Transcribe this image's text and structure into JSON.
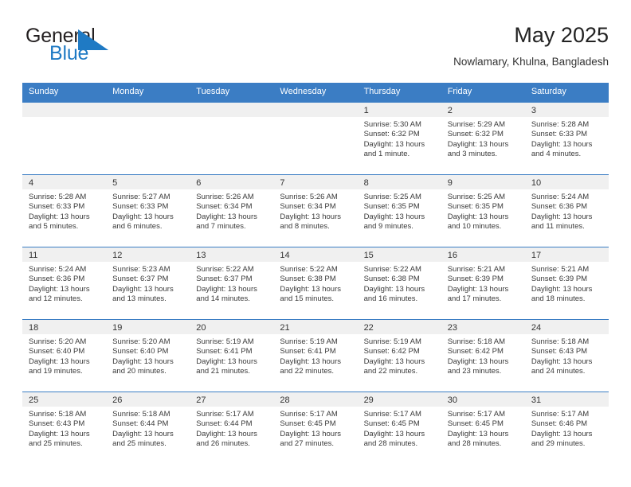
{
  "brand": {
    "name_part1": "General",
    "name_part2": "Blue",
    "accent_color": "#1f7ac4",
    "triangle_icon": "triangle-icon"
  },
  "header": {
    "title": "May 2025",
    "subtitle": "Nowlamary, Khulna, Bangladesh"
  },
  "calendar": {
    "header_bg": "#3b7dc4",
    "weekdays": [
      "Sunday",
      "Monday",
      "Tuesday",
      "Wednesday",
      "Thursday",
      "Friday",
      "Saturday"
    ],
    "weeks": [
      [
        {
          "day": "",
          "empty": true
        },
        {
          "day": "",
          "empty": true
        },
        {
          "day": "",
          "empty": true
        },
        {
          "day": "",
          "empty": true
        },
        {
          "day": "1",
          "sunrise": "Sunrise: 5:30 AM",
          "sunset": "Sunset: 6:32 PM",
          "daylight": "Daylight: 13 hours and 1 minute."
        },
        {
          "day": "2",
          "sunrise": "Sunrise: 5:29 AM",
          "sunset": "Sunset: 6:32 PM",
          "daylight": "Daylight: 13 hours and 3 minutes."
        },
        {
          "day": "3",
          "sunrise": "Sunrise: 5:28 AM",
          "sunset": "Sunset: 6:33 PM",
          "daylight": "Daylight: 13 hours and 4 minutes."
        }
      ],
      [
        {
          "day": "4",
          "sunrise": "Sunrise: 5:28 AM",
          "sunset": "Sunset: 6:33 PM",
          "daylight": "Daylight: 13 hours and 5 minutes."
        },
        {
          "day": "5",
          "sunrise": "Sunrise: 5:27 AM",
          "sunset": "Sunset: 6:33 PM",
          "daylight": "Daylight: 13 hours and 6 minutes."
        },
        {
          "day": "6",
          "sunrise": "Sunrise: 5:26 AM",
          "sunset": "Sunset: 6:34 PM",
          "daylight": "Daylight: 13 hours and 7 minutes."
        },
        {
          "day": "7",
          "sunrise": "Sunrise: 5:26 AM",
          "sunset": "Sunset: 6:34 PM",
          "daylight": "Daylight: 13 hours and 8 minutes."
        },
        {
          "day": "8",
          "sunrise": "Sunrise: 5:25 AM",
          "sunset": "Sunset: 6:35 PM",
          "daylight": "Daylight: 13 hours and 9 minutes."
        },
        {
          "day": "9",
          "sunrise": "Sunrise: 5:25 AM",
          "sunset": "Sunset: 6:35 PM",
          "daylight": "Daylight: 13 hours and 10 minutes."
        },
        {
          "day": "10",
          "sunrise": "Sunrise: 5:24 AM",
          "sunset": "Sunset: 6:36 PM",
          "daylight": "Daylight: 13 hours and 11 minutes."
        }
      ],
      [
        {
          "day": "11",
          "sunrise": "Sunrise: 5:24 AM",
          "sunset": "Sunset: 6:36 PM",
          "daylight": "Daylight: 13 hours and 12 minutes."
        },
        {
          "day": "12",
          "sunrise": "Sunrise: 5:23 AM",
          "sunset": "Sunset: 6:37 PM",
          "daylight": "Daylight: 13 hours and 13 minutes."
        },
        {
          "day": "13",
          "sunrise": "Sunrise: 5:22 AM",
          "sunset": "Sunset: 6:37 PM",
          "daylight": "Daylight: 13 hours and 14 minutes."
        },
        {
          "day": "14",
          "sunrise": "Sunrise: 5:22 AM",
          "sunset": "Sunset: 6:38 PM",
          "daylight": "Daylight: 13 hours and 15 minutes."
        },
        {
          "day": "15",
          "sunrise": "Sunrise: 5:22 AM",
          "sunset": "Sunset: 6:38 PM",
          "daylight": "Daylight: 13 hours and 16 minutes."
        },
        {
          "day": "16",
          "sunrise": "Sunrise: 5:21 AM",
          "sunset": "Sunset: 6:39 PM",
          "daylight": "Daylight: 13 hours and 17 minutes."
        },
        {
          "day": "17",
          "sunrise": "Sunrise: 5:21 AM",
          "sunset": "Sunset: 6:39 PM",
          "daylight": "Daylight: 13 hours and 18 minutes."
        }
      ],
      [
        {
          "day": "18",
          "sunrise": "Sunrise: 5:20 AM",
          "sunset": "Sunset: 6:40 PM",
          "daylight": "Daylight: 13 hours and 19 minutes."
        },
        {
          "day": "19",
          "sunrise": "Sunrise: 5:20 AM",
          "sunset": "Sunset: 6:40 PM",
          "daylight": "Daylight: 13 hours and 20 minutes."
        },
        {
          "day": "20",
          "sunrise": "Sunrise: 5:19 AM",
          "sunset": "Sunset: 6:41 PM",
          "daylight": "Daylight: 13 hours and 21 minutes."
        },
        {
          "day": "21",
          "sunrise": "Sunrise: 5:19 AM",
          "sunset": "Sunset: 6:41 PM",
          "daylight": "Daylight: 13 hours and 22 minutes."
        },
        {
          "day": "22",
          "sunrise": "Sunrise: 5:19 AM",
          "sunset": "Sunset: 6:42 PM",
          "daylight": "Daylight: 13 hours and 22 minutes."
        },
        {
          "day": "23",
          "sunrise": "Sunrise: 5:18 AM",
          "sunset": "Sunset: 6:42 PM",
          "daylight": "Daylight: 13 hours and 23 minutes."
        },
        {
          "day": "24",
          "sunrise": "Sunrise: 5:18 AM",
          "sunset": "Sunset: 6:43 PM",
          "daylight": "Daylight: 13 hours and 24 minutes."
        }
      ],
      [
        {
          "day": "25",
          "sunrise": "Sunrise: 5:18 AM",
          "sunset": "Sunset: 6:43 PM",
          "daylight": "Daylight: 13 hours and 25 minutes."
        },
        {
          "day": "26",
          "sunrise": "Sunrise: 5:18 AM",
          "sunset": "Sunset: 6:44 PM",
          "daylight": "Daylight: 13 hours and 25 minutes."
        },
        {
          "day": "27",
          "sunrise": "Sunrise: 5:17 AM",
          "sunset": "Sunset: 6:44 PM",
          "daylight": "Daylight: 13 hours and 26 minutes."
        },
        {
          "day": "28",
          "sunrise": "Sunrise: 5:17 AM",
          "sunset": "Sunset: 6:45 PM",
          "daylight": "Daylight: 13 hours and 27 minutes."
        },
        {
          "day": "29",
          "sunrise": "Sunrise: 5:17 AM",
          "sunset": "Sunset: 6:45 PM",
          "daylight": "Daylight: 13 hours and 28 minutes."
        },
        {
          "day": "30",
          "sunrise": "Sunrise: 5:17 AM",
          "sunset": "Sunset: 6:45 PM",
          "daylight": "Daylight: 13 hours and 28 minutes."
        },
        {
          "day": "31",
          "sunrise": "Sunrise: 5:17 AM",
          "sunset": "Sunset: 6:46 PM",
          "daylight": "Daylight: 13 hours and 29 minutes."
        }
      ]
    ]
  }
}
